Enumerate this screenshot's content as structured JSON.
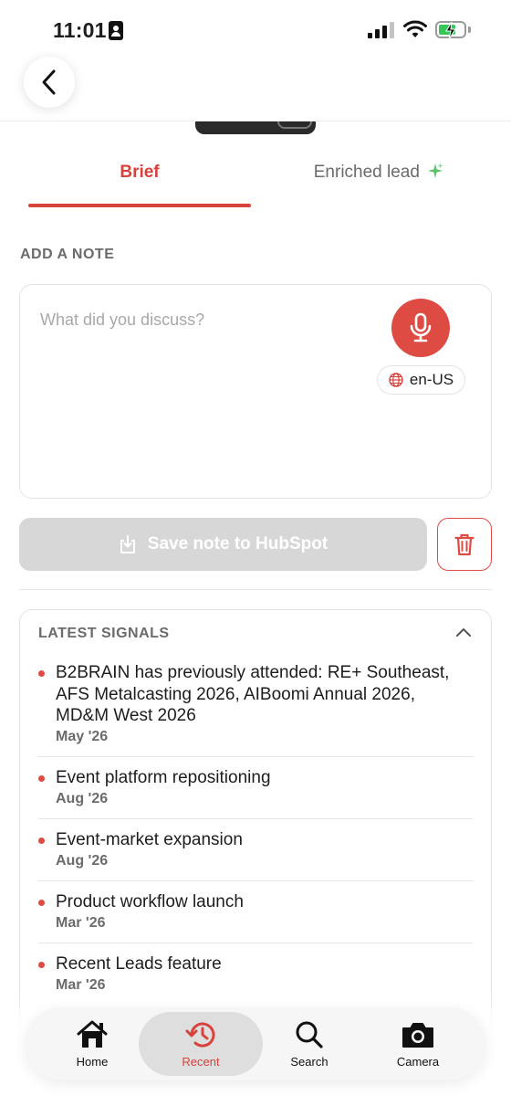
{
  "status_bar": {
    "time": "11:01"
  },
  "tabs": [
    {
      "label": "Brief",
      "active": true
    },
    {
      "label": "Enriched lead",
      "icon": "sparkle-icon"
    }
  ],
  "note": {
    "section_label": "ADD A NOTE",
    "placeholder": "What did you discuss?",
    "language": "en-US"
  },
  "actions": {
    "save_label": "Save note to HubSpot"
  },
  "signals": {
    "title": "LATEST SIGNALS",
    "items": [
      {
        "text": "B2BRAIN has previously attended: RE+ Southeast, AFS Metalcasting 2026, AIBoomi Annual 2026, MD&M West 2026",
        "date": "May '26"
      },
      {
        "text": "Event platform repositioning",
        "date": "Aug '26"
      },
      {
        "text": "Event-market expansion",
        "date": "Aug '26"
      },
      {
        "text": "Product workflow launch",
        "date": "Mar '26"
      },
      {
        "text": "Recent Leads feature",
        "date": "Mar '26"
      }
    ]
  },
  "nav": {
    "items": [
      {
        "label": "Home",
        "icon": "home-icon"
      },
      {
        "label": "Recent",
        "icon": "history-icon",
        "active": true
      },
      {
        "label": "Search",
        "icon": "search-icon"
      },
      {
        "label": "Camera",
        "icon": "camera-icon"
      }
    ]
  },
  "colors": {
    "accent": "#de4b43",
    "muted": "#6b6b6b",
    "disabled": "#d7d7d7"
  }
}
